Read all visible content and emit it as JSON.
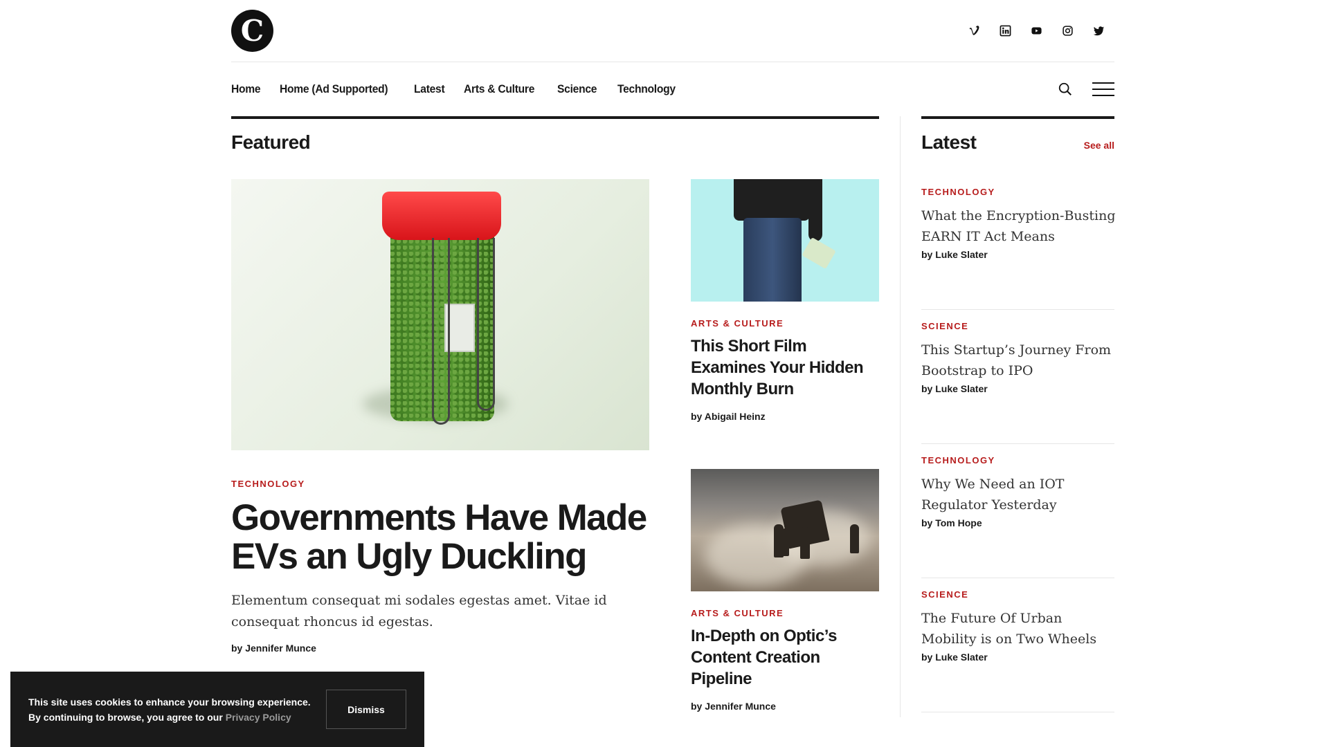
{
  "brand": {
    "logo_letter": "C"
  },
  "header": {
    "socials": [
      {
        "name": "vimeo-icon"
      },
      {
        "name": "linkedin-icon"
      },
      {
        "name": "youtube-icon"
      },
      {
        "name": "instagram-icon"
      },
      {
        "name": "twitter-icon"
      }
    ]
  },
  "nav": {
    "items": [
      "Home",
      "Home (Ad Supported)",
      "Latest",
      "Arts & Culture",
      "Science",
      "Technology"
    ],
    "search_icon": "search-icon",
    "menu_icon": "hamburger-menu-icon"
  },
  "featured": {
    "title": "Featured",
    "main": {
      "category": "TECHNOLOGY",
      "title": "Governments Have Made EVs an Ugly Duckling",
      "excerpt": "Elementum consequat mi sodales egestas amet. Vitae id consequat rhoncus id egestas.",
      "byline": "by Jennifer Munce"
    },
    "cards": [
      {
        "category": "ARTS & CULTURE",
        "title": "This Short Film Examines Your Hidden Monthly Burn",
        "byline": "by Abigail Heinz"
      },
      {
        "category": "ARTS & CULTURE",
        "title": "In-Depth on Optic’s Content Creation Pipeline",
        "byline": "by Jennifer Munce"
      }
    ]
  },
  "latest": {
    "title": "Latest",
    "see_all": "See all",
    "items": [
      {
        "category": "TECHNOLOGY",
        "title": "What the Encryption-Busting EARN IT Act Means",
        "byline": "by Luke Slater"
      },
      {
        "category": "SCIENCE",
        "title": "This Startup’s Journey From Bootstrap to IPO",
        "byline": "by Luke Slater"
      },
      {
        "category": "TECHNOLOGY",
        "title": "Why We Need an IOT Regulator Yesterday",
        "byline": "by Tom Hope"
      },
      {
        "category": "SCIENCE",
        "title": "The Future Of Urban Mobility is on Two Wheels",
        "byline": "by Luke Slater"
      }
    ]
  },
  "cookie": {
    "text": "This site uses cookies to enhance your browsing experience. By continuing to browse, you agree to our",
    "link": "Privacy Policy",
    "dismiss": "Dismiss"
  },
  "colors": {
    "accent": "#b71c1c",
    "text": "#1a1a1a",
    "banner": "#1a1a1a"
  }
}
